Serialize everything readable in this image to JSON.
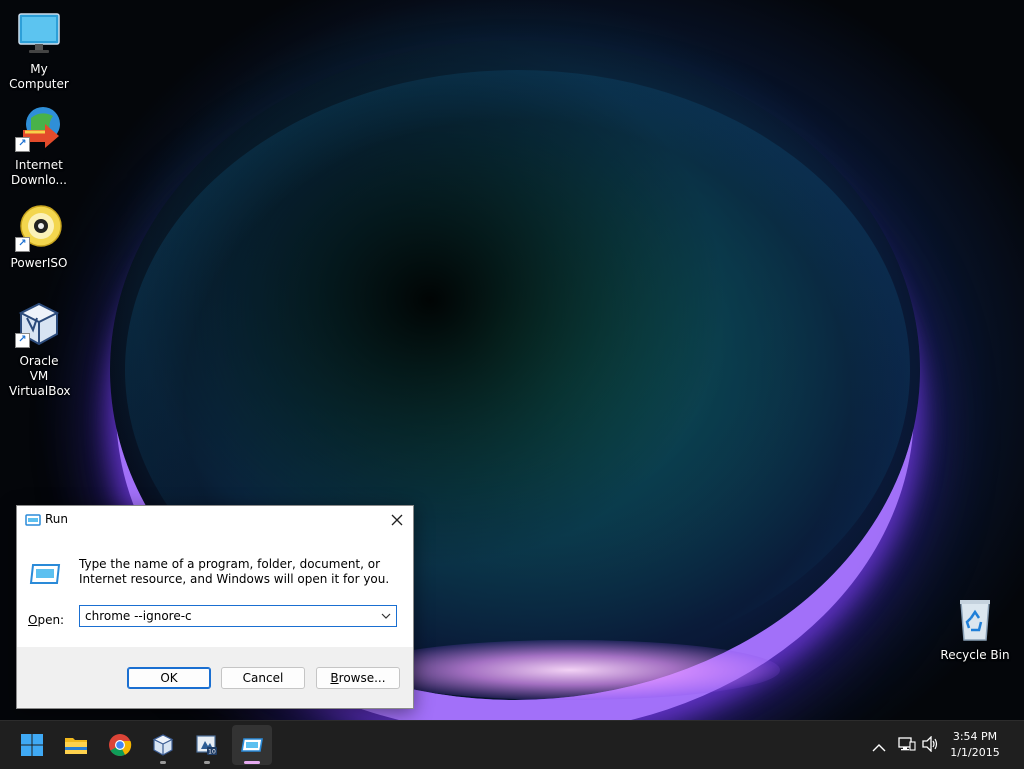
{
  "desktop_icons": [
    {
      "label": "My Computer"
    },
    {
      "label": "Internet Downlo..."
    },
    {
      "label": "PowerISO"
    },
    {
      "label": "Oracle VM VirtualBox"
    },
    {
      "label": "Recycle Bin"
    }
  ],
  "run_dialog": {
    "title": "Run",
    "description": "Type the name of a program, folder, document, or Internet resource, and Windows will open it for you.",
    "open_label_prefix": "",
    "open_label_accel": "O",
    "open_label_rest": "pen:",
    "open_value": "chrome --ignore-c",
    "ok_label": "OK",
    "cancel_label": "Cancel",
    "browse_label_accel": "B",
    "browse_label_rest": "rowse..."
  },
  "taskbar": {
    "items": [
      {
        "name": "start",
        "icon": "windows-logo-icon"
      },
      {
        "name": "file-explorer",
        "icon": "folder-icon"
      },
      {
        "name": "chrome",
        "icon": "chrome-icon"
      },
      {
        "name": "virtualbox",
        "icon": "virtualbox-icon"
      },
      {
        "name": "app-10",
        "icon": "app-icon"
      },
      {
        "name": "run",
        "icon": "run-icon"
      }
    ],
    "clock": {
      "time": "3:54 PM",
      "date": "1/1/2015"
    }
  },
  "colors": {
    "accent": "#1a6fd1",
    "taskbar": "#1f1f1f",
    "dialog_footer": "#f0f0f0"
  }
}
